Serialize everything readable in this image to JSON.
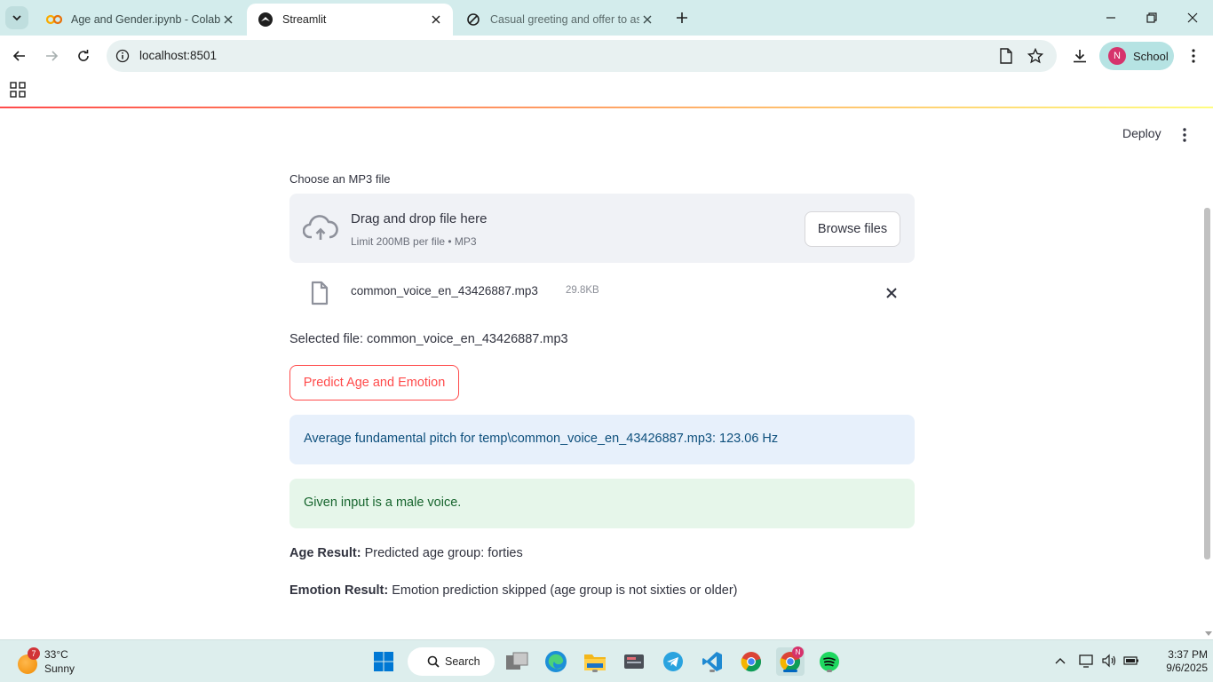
{
  "browser": {
    "tabs": [
      {
        "title": "Age and Gender.ipynb - Colab",
        "favicon": "colab-icon",
        "active": false
      },
      {
        "title": "Streamlit",
        "favicon": "streamlit-icon",
        "active": true
      },
      {
        "title": "Casual greeting and offer to ass",
        "favicon": "chatgpt-icon",
        "active": false
      }
    ],
    "url": "localhost:8501",
    "profile_initial": "N",
    "profile_name": "School"
  },
  "app": {
    "deploy_label": "Deploy",
    "uploader": {
      "label": "Choose an MP3 file",
      "drag_text": "Drag and drop file here",
      "limit_text": "Limit 200MB per file • MP3",
      "browse_label": "Browse files"
    },
    "uploaded_file": {
      "name": "common_voice_en_43426887.mp3",
      "size": "29.8KB"
    },
    "selected_file_text": "Selected file: common_voice_en_43426887.mp3",
    "predict_button_label": "Predict Age and Emotion",
    "info_message": "Average fundamental pitch for temp\\common_voice_en_43426887.mp3: 123.06 Hz",
    "success_message": "Given input is a male voice.",
    "age_result": {
      "label": "Age Result:",
      "value": "Predicted age group: forties"
    },
    "emotion_result": {
      "label": "Emotion Result:",
      "value": "Emotion prediction skipped (age group is not sixties or older)"
    },
    "accent_color": "#ff4b4b"
  },
  "taskbar": {
    "weather": {
      "badge": "7",
      "temperature": "33°C",
      "condition": "Sunny"
    },
    "search_label": "Search",
    "chrome_badge": "N",
    "time": "3:37 PM",
    "date": "9/6/2025"
  }
}
